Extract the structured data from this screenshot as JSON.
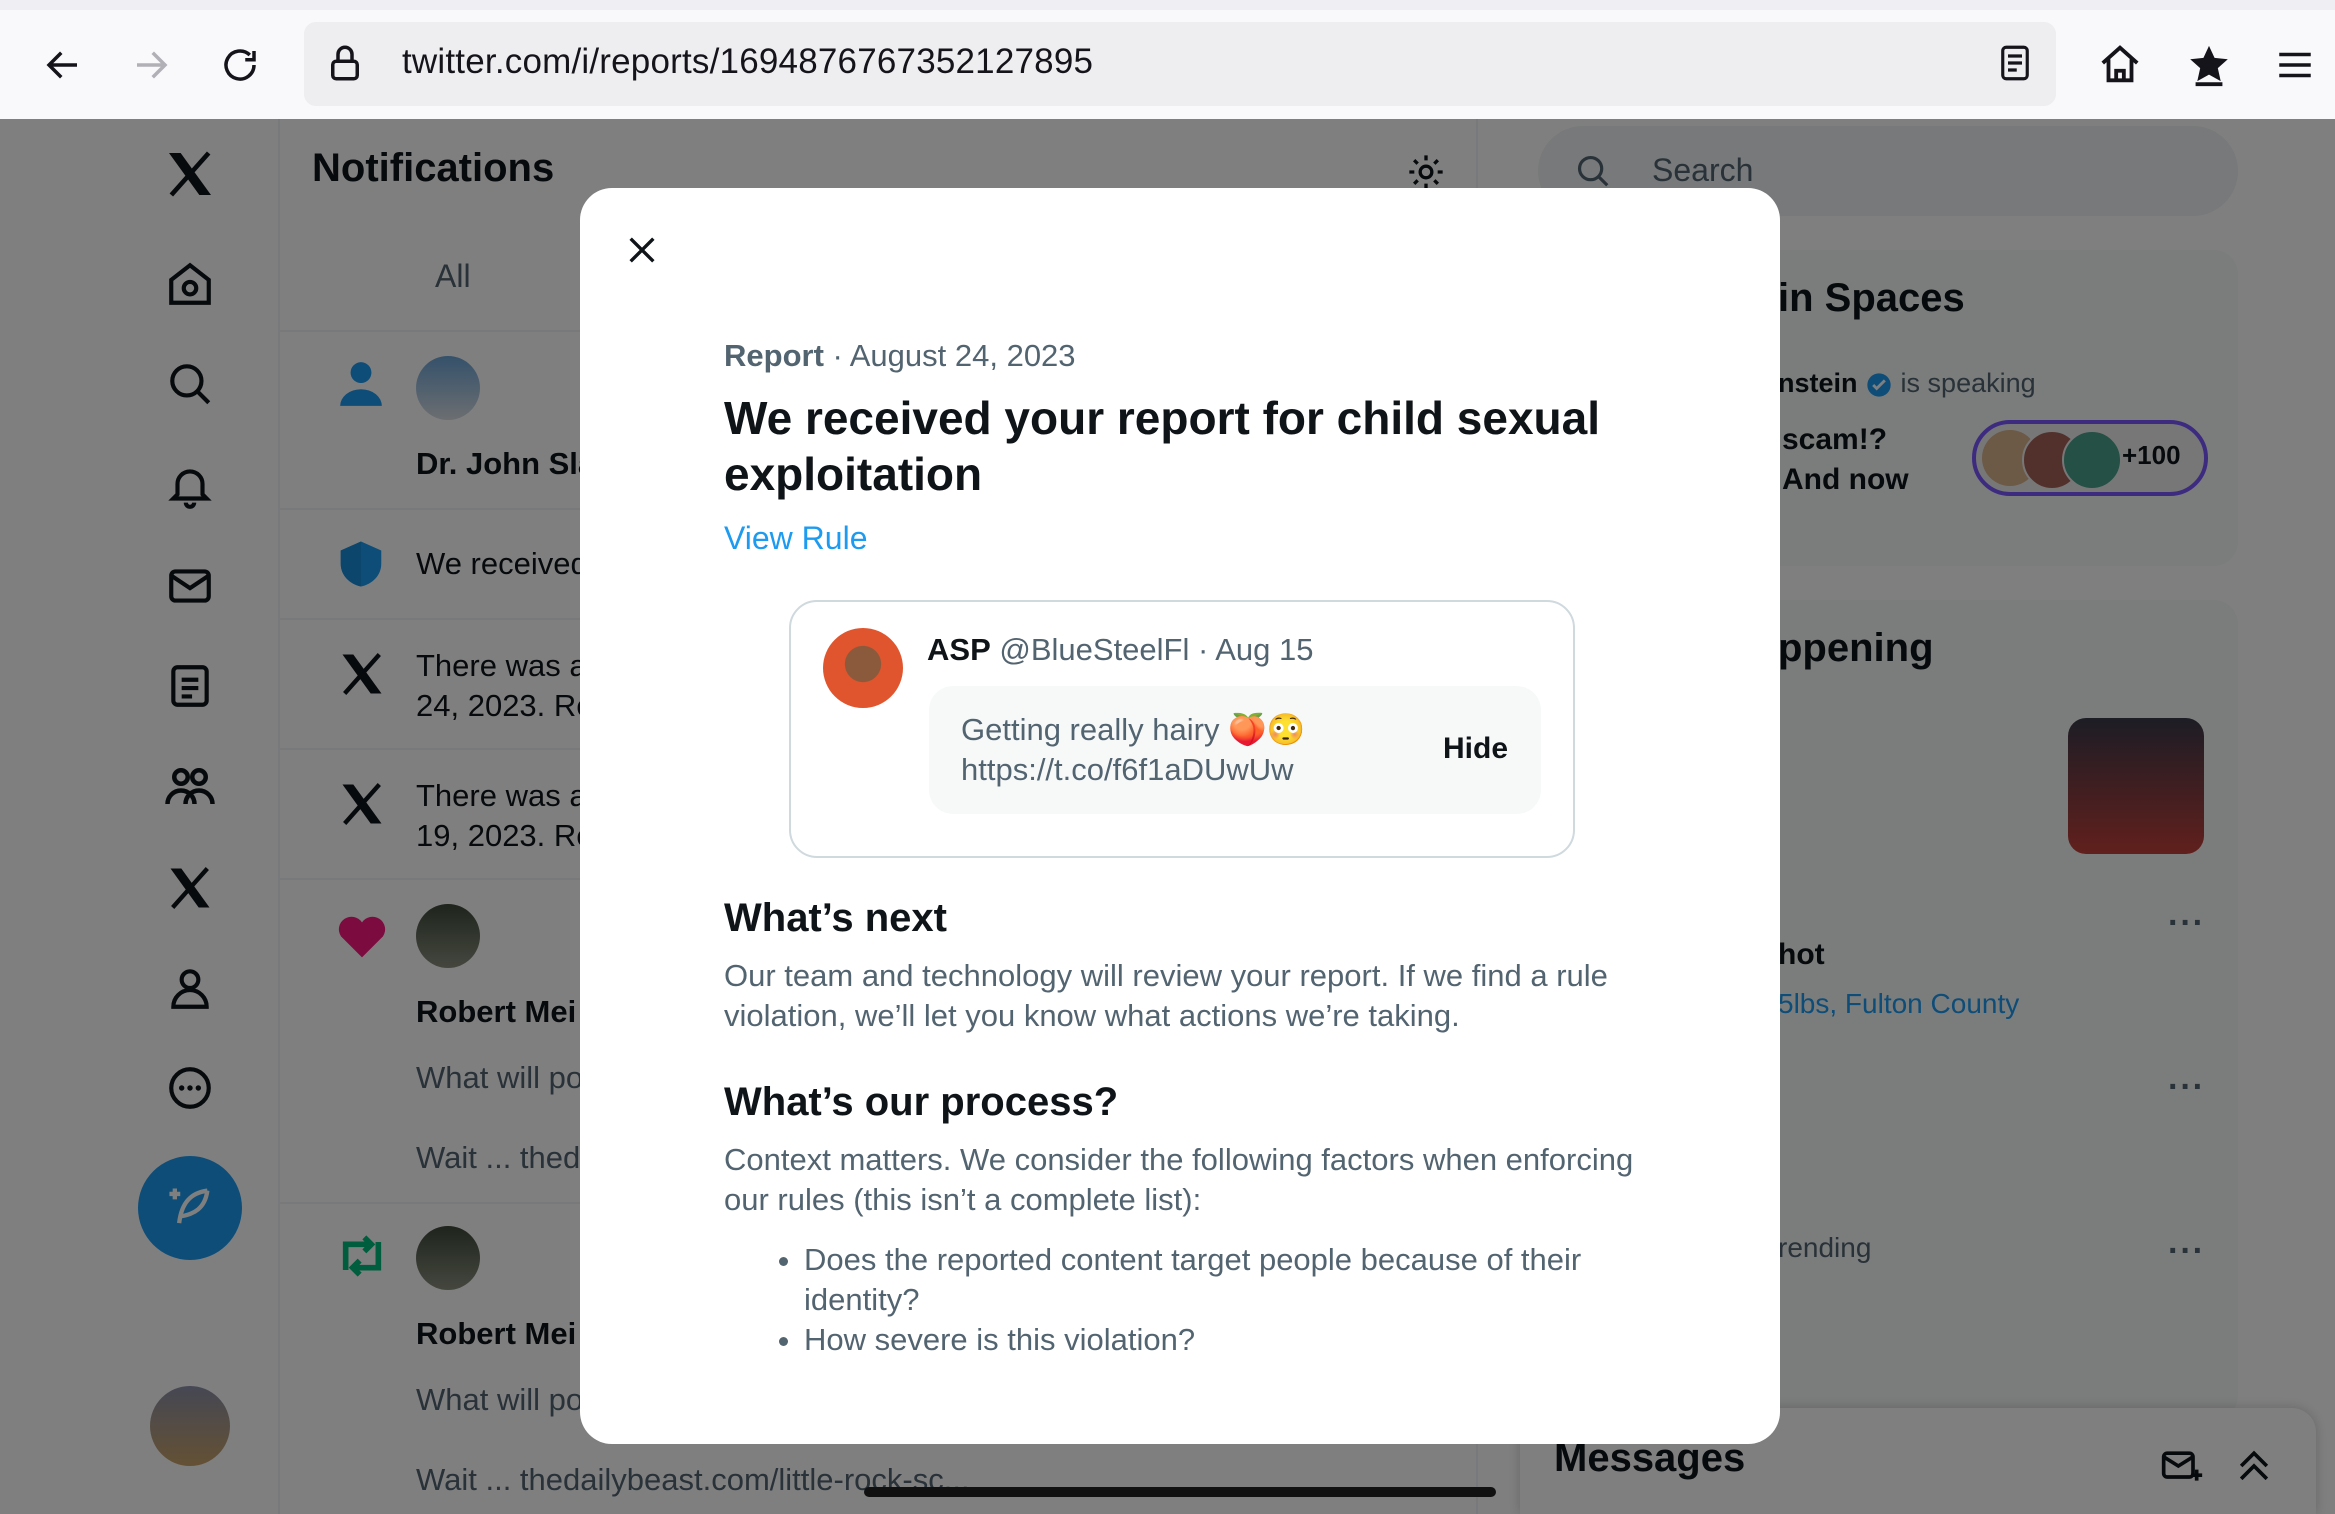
{
  "browser": {
    "url": "twitter.com/i/reports/1694876767352127895"
  },
  "sidebar": {
    "items": [
      "x-logo",
      "home",
      "explore",
      "notifications",
      "messages",
      "lists",
      "communities",
      "premium",
      "profile",
      "more"
    ]
  },
  "notifications": {
    "title": "Notifications",
    "tab_all": "All",
    "rows": [
      {
        "name": "Dr. John Sla"
      },
      {
        "text": "We received"
      },
      {
        "line1": "There was a",
        "line2": "24, 2023. Re"
      },
      {
        "line1": "There was a",
        "line2": "19, 2023. Re"
      },
      {
        "name": "Robert Mei",
        "line1": "What will po",
        "line2": "Wait ... thed"
      },
      {
        "name": "Robert Mei",
        "line1": "What will po",
        "line2": "Wait ... thedailybeast.com/little-rock-sc..."
      }
    ]
  },
  "right_column": {
    "search_placeholder": "Search",
    "spaces": {
      "title": "in Spaces",
      "speaker": "nstein",
      "speaking": "is speaking",
      "line1": "scam!?",
      "line2": "And now",
      "count": "+100"
    },
    "happening": {
      "title": "ppening",
      "item_title": "hot",
      "item_links": "5lbs, Fulton County",
      "trending": "rending"
    },
    "messages_title": "Messages"
  },
  "modal": {
    "report_label": "Report",
    "report_date": "· August 24, 2023",
    "headline": "We received your report for child sexual exploitation",
    "view_rule": "View Rule",
    "tweet": {
      "name": "ASP",
      "handle_date": "@BlueSteelFl · Aug 15",
      "text_line1": "Getting really hairy 🍑😳",
      "text_line2": "https://t.co/f6f1aDUwUw",
      "hide": "Hide"
    },
    "whats_next_title": "What’s next",
    "whats_next_body": "Our team and technology will review your report. If we find a rule violation, we’ll let you know what actions we’re taking.",
    "process_title": "What’s our process?",
    "process_body": "Context matters. We consider the following factors when enforcing our rules (this isn’t a complete list):",
    "bullets": [
      "Does the reported content target people because of their identity?",
      "How severe is this violation?"
    ]
  },
  "colors": {
    "accent": "#1d9bf0",
    "text": "#0f1419",
    "muted": "#536471"
  }
}
